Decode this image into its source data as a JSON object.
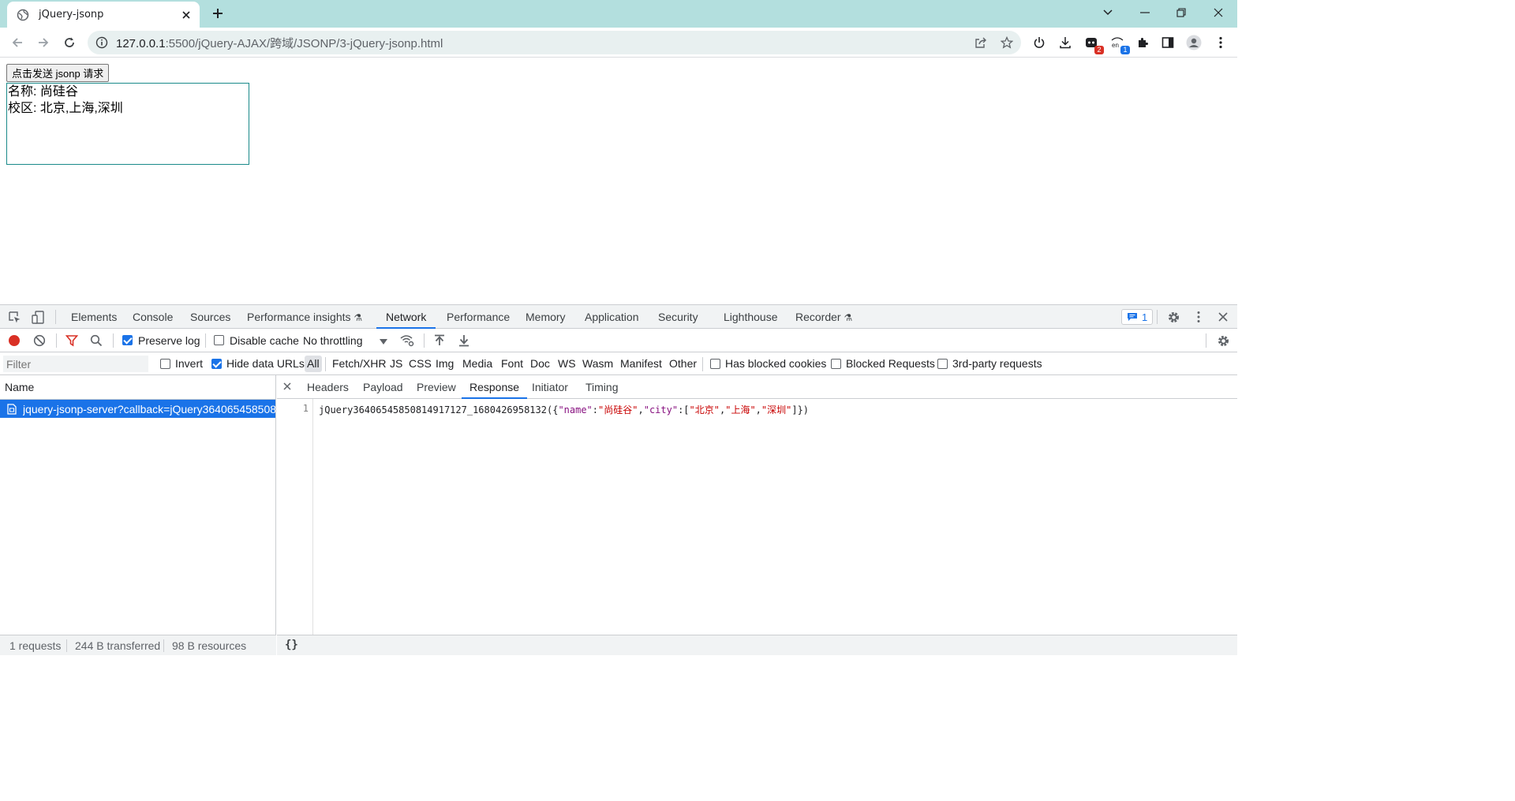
{
  "browser": {
    "tab_title": "jQuery-jsonp",
    "url_host": "127.0.0.1",
    "url_path": ":5500/jQuery-AJAX/跨域/JSONP/3-jQuery-jsonp.html",
    "new_tab_icon": "plus-icon",
    "extensions": [
      {
        "name": "extension-badge-icon",
        "badge": "2",
        "badge_color": "#d93025"
      },
      {
        "name": "translate-extension-icon",
        "badge": "1",
        "badge_color": "#1a73e8",
        "label": "en"
      }
    ]
  },
  "page": {
    "send_button": "点击发送 jsonp 请求",
    "result_name_line": "名称: 尚硅谷",
    "result_city_line": "校区: 北京,上海,深圳"
  },
  "devtools": {
    "tabs": [
      "Elements",
      "Console",
      "Sources",
      "Performance insights",
      "Network",
      "Performance",
      "Memory",
      "Application",
      "Security",
      "Lighthouse",
      "Recorder"
    ],
    "active_tab": "Network",
    "issues_count": "1",
    "toolbar": {
      "preserve_log": "Preserve log",
      "preserve_log_checked": true,
      "disable_cache": "Disable cache",
      "disable_cache_checked": false,
      "throttling": "No throttling"
    },
    "filter": {
      "placeholder": "Filter",
      "invert": "Invert",
      "hide_data_urls": "Hide data URLs",
      "types": [
        "All",
        "Fetch/XHR",
        "JS",
        "CSS",
        "Img",
        "Media",
        "Font",
        "Doc",
        "WS",
        "Wasm",
        "Manifest",
        "Other"
      ],
      "active_type": "All",
      "has_blocked_cookies": "Has blocked cookies",
      "blocked_requests": "Blocked Requests",
      "third_party": "3rd-party requests"
    },
    "list": {
      "header": "Name",
      "rows": [
        {
          "name": "jquery-jsonp-server?callback=jQuery364065458508..."
        }
      ]
    },
    "status": {
      "requests": "1 requests",
      "transferred": "244 B transferred",
      "resources": "98 B resources"
    },
    "detail": {
      "tabs": [
        "Headers",
        "Payload",
        "Preview",
        "Response",
        "Initiator",
        "Timing"
      ],
      "active_tab": "Response",
      "line_number": "1",
      "callback": "jQuery36406545850814917127_1680426958132",
      "key_name": "\"name\"",
      "val_name": "\"尚硅谷\"",
      "key_city": "\"city\"",
      "city_1": "\"北京\"",
      "city_2": "\"上海\"",
      "city_3": "\"深圳\"",
      "footer": "{}"
    }
  }
}
